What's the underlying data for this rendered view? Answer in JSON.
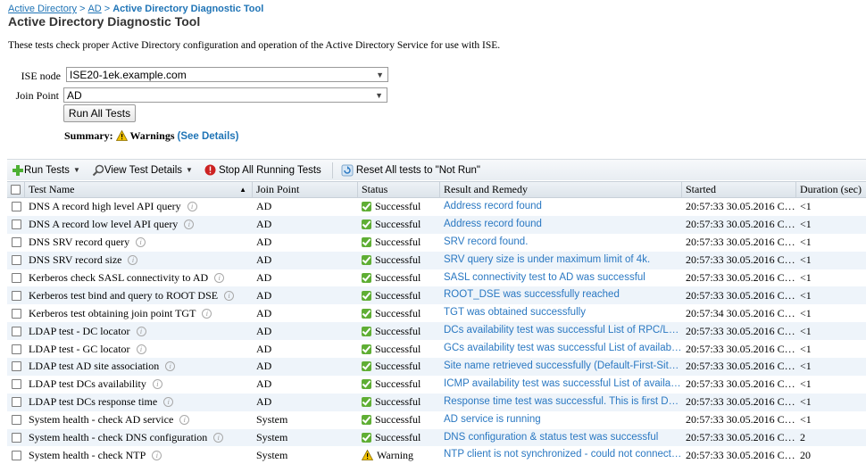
{
  "breadcrumb": {
    "items": [
      "Active Directory",
      "AD"
    ],
    "separator": ">",
    "current": "Active Directory Diagnostic Tool"
  },
  "title": "Active Directory Diagnostic Tool",
  "description": "These tests check proper Active Directory configuration and operation of the Active Directory Service for use with ISE.",
  "form": {
    "ise_node_label": "ISE node",
    "ise_node_value": "ISE20-1ek.example.com",
    "join_point_label": "Join Point",
    "join_point_value": "AD",
    "run_all_label": "Run All Tests"
  },
  "summary": {
    "label": "Summary:",
    "status": "Warnings",
    "details_link": "(See Details)"
  },
  "toolbar": {
    "run_tests": "Run Tests",
    "view_test_details": "View Test Details",
    "stop_all": "Stop All Running Tests",
    "reset_all": "Reset All tests to \"Not Run\""
  },
  "table": {
    "headers": {
      "name": "Test Name",
      "join_point": "Join Point",
      "status": "Status",
      "result": "Result and Remedy",
      "started": "Started",
      "duration": "Duration (sec)"
    },
    "rows": [
      {
        "name": "DNS A record high level API query",
        "join_point": "AD",
        "status": "Successful",
        "result": "Address record found",
        "started": "20:57:33 30.05.2016 C…",
        "duration": "<1"
      },
      {
        "name": "DNS A record low level API query",
        "join_point": "AD",
        "status": "Successful",
        "result": "Address record found",
        "started": "20:57:33 30.05.2016 C…",
        "duration": "<1"
      },
      {
        "name": "DNS SRV record query",
        "join_point": "AD",
        "status": "Successful",
        "result": "SRV record found.",
        "started": "20:57:33 30.05.2016 C…",
        "duration": "<1"
      },
      {
        "name": "DNS SRV record size",
        "join_point": "AD",
        "status": "Successful",
        "result": "SRV query size is under maximum limit of 4k.",
        "started": "20:57:33 30.05.2016 C…",
        "duration": "<1"
      },
      {
        "name": "Kerberos check SASL connectivity to AD",
        "join_point": "AD",
        "status": "Successful",
        "result": "SASL connectivity test to AD was successful",
        "started": "20:57:33 30.05.2016 C…",
        "duration": "<1"
      },
      {
        "name": "Kerberos test bind and query to ROOT DSE",
        "join_point": "AD",
        "status": "Successful",
        "result": "ROOT_DSE was successfully reached",
        "started": "20:57:33 30.05.2016 C…",
        "duration": "<1"
      },
      {
        "name": "Kerberos test obtaining join point TGT",
        "join_point": "AD",
        "status": "Successful",
        "result": "TGT was obtained successfully",
        "started": "20:57:34 30.05.2016 C…",
        "duration": "<1"
      },
      {
        "name": "LDAP test - DC locator",
        "join_point": "AD",
        "status": "Successful",
        "result": "DCs availability test was successful List of RPC/LD…",
        "started": "20:57:33 30.05.2016 C…",
        "duration": "<1"
      },
      {
        "name": "LDAP test - GC locator",
        "join_point": "AD",
        "status": "Successful",
        "result": "GCs availability test was successful List of available…",
        "started": "20:57:33 30.05.2016 C…",
        "duration": "<1"
      },
      {
        "name": "LDAP test AD site association",
        "join_point": "AD",
        "status": "Successful",
        "result": "Site name retrieved successfully (Default-First-Site-…",
        "started": "20:57:33 30.05.2016 C…",
        "duration": "<1"
      },
      {
        "name": "LDAP test DCs availability",
        "join_point": "AD",
        "status": "Successful",
        "result": "ICMP availability test was successful List of availabl…",
        "started": "20:57:33 30.05.2016 C…",
        "duration": "<1"
      },
      {
        "name": "LDAP test DCs response time",
        "join_point": "AD",
        "status": "Successful",
        "result": "Response time test was successful. This is first DC …",
        "started": "20:57:33 30.05.2016 C…",
        "duration": "<1"
      },
      {
        "name": "System health - check AD service",
        "join_point": "System",
        "status": "Successful",
        "result": "AD service is running",
        "started": "20:57:33 30.05.2016 C…",
        "duration": "<1"
      },
      {
        "name": "System health - check DNS configuration",
        "join_point": "System",
        "status": "Successful",
        "result": "DNS configuration & status test was successful",
        "started": "20:57:33 30.05.2016 C…",
        "duration": "2"
      },
      {
        "name": "System health - check NTP",
        "join_point": "System",
        "status": "Warning",
        "result": "NTP client is not synchronized - could not connect t…",
        "started": "20:57:33 30.05.2016 C…",
        "duration": "20"
      }
    ]
  },
  "colors": {
    "link": "#1f74b6",
    "result_text": "#2a78c2",
    "success": "#5fae34",
    "warning": "#f2c200",
    "stop": "#cc2222",
    "row_alt": "#eef4fa"
  }
}
